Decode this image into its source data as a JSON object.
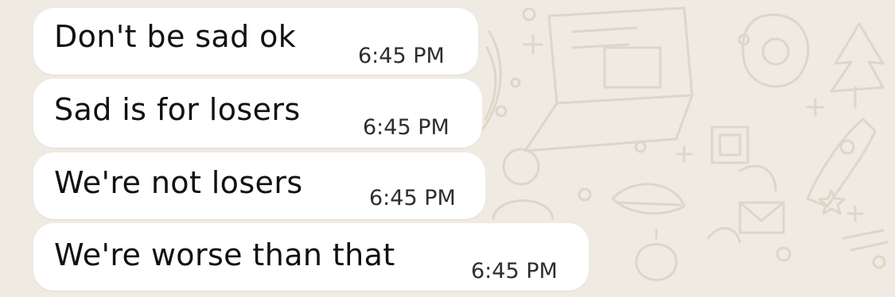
{
  "chat": {
    "messages": [
      {
        "text": "Don't be sad ok",
        "time": "6:45 PM"
      },
      {
        "text": "Sad is for losers",
        "time": "6:45 PM"
      },
      {
        "text": "We're not losers",
        "time": "6:45 PM"
      },
      {
        "text": "We're worse than that",
        "time": "6:45 PM"
      }
    ]
  },
  "colors": {
    "chat_background": "#efeae2",
    "bubble": "#ffffff",
    "message_text": "#111111",
    "timestamp": "#2e2e2e",
    "doodle_pattern": "#ddd6c9"
  },
  "icons": [
    "chat-wallpaper-doodle-pattern"
  ]
}
